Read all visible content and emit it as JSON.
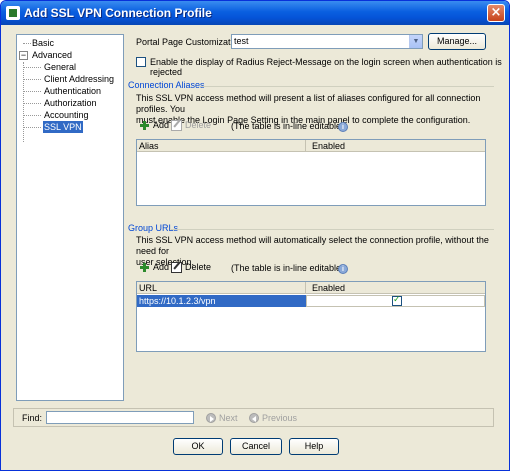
{
  "window": {
    "title": "Add SSL VPN Connection Profile",
    "close_label": "×"
  },
  "tree": {
    "basic": "Basic",
    "advanced": "Advanced",
    "expander": "−",
    "children": [
      "General",
      "Client Addressing",
      "Authentication",
      "Authorization",
      "Accounting",
      "SSL VPN"
    ],
    "selected": "SSL VPN"
  },
  "portal": {
    "label": "Portal Page Customization:",
    "value": "test",
    "manage_label": "Manage...",
    "radius_checkbox_label": "Enable the display of Radius Reject-Message on the login screen when authentication is rejected",
    "radius_checked": false
  },
  "connection_aliases": {
    "title": "Connection Aliases",
    "description_line1": "This SSL VPN access method will present a list of aliases configured for all connection profiles. You",
    "description_line2": "must enable the Login Page Setting in the main panel to complete the configuration.",
    "add_label": "Add",
    "delete_label": "Delete",
    "delete_enabled": false,
    "inline_note": "(The table is in-line editable.)",
    "columns": [
      "Alias",
      "Enabled"
    ],
    "rows": []
  },
  "group_urls": {
    "title": "Group URLs",
    "description_line1": "This SSL VPN access method will automatically select the connection profile, without the need for",
    "description_line2": "user selection.",
    "add_label": "Add",
    "delete_label": "Delete",
    "inline_note": "(The table is in-line editable.)",
    "columns": [
      "URL",
      "Enabled"
    ],
    "rows": [
      {
        "url": "https://10.1.2.3/vpn",
        "enabled": true
      }
    ]
  },
  "find": {
    "label": "Find:",
    "value": "",
    "next_label": "Next",
    "previous_label": "Previous"
  },
  "footer": {
    "ok_label": "OK",
    "cancel_label": "Cancel",
    "help_label": "Help"
  },
  "colors": {
    "title_bar": "#0a5fe0",
    "selection": "#316ac5",
    "section_title": "#0046d5",
    "dialog_bg": "#ece9d8"
  }
}
